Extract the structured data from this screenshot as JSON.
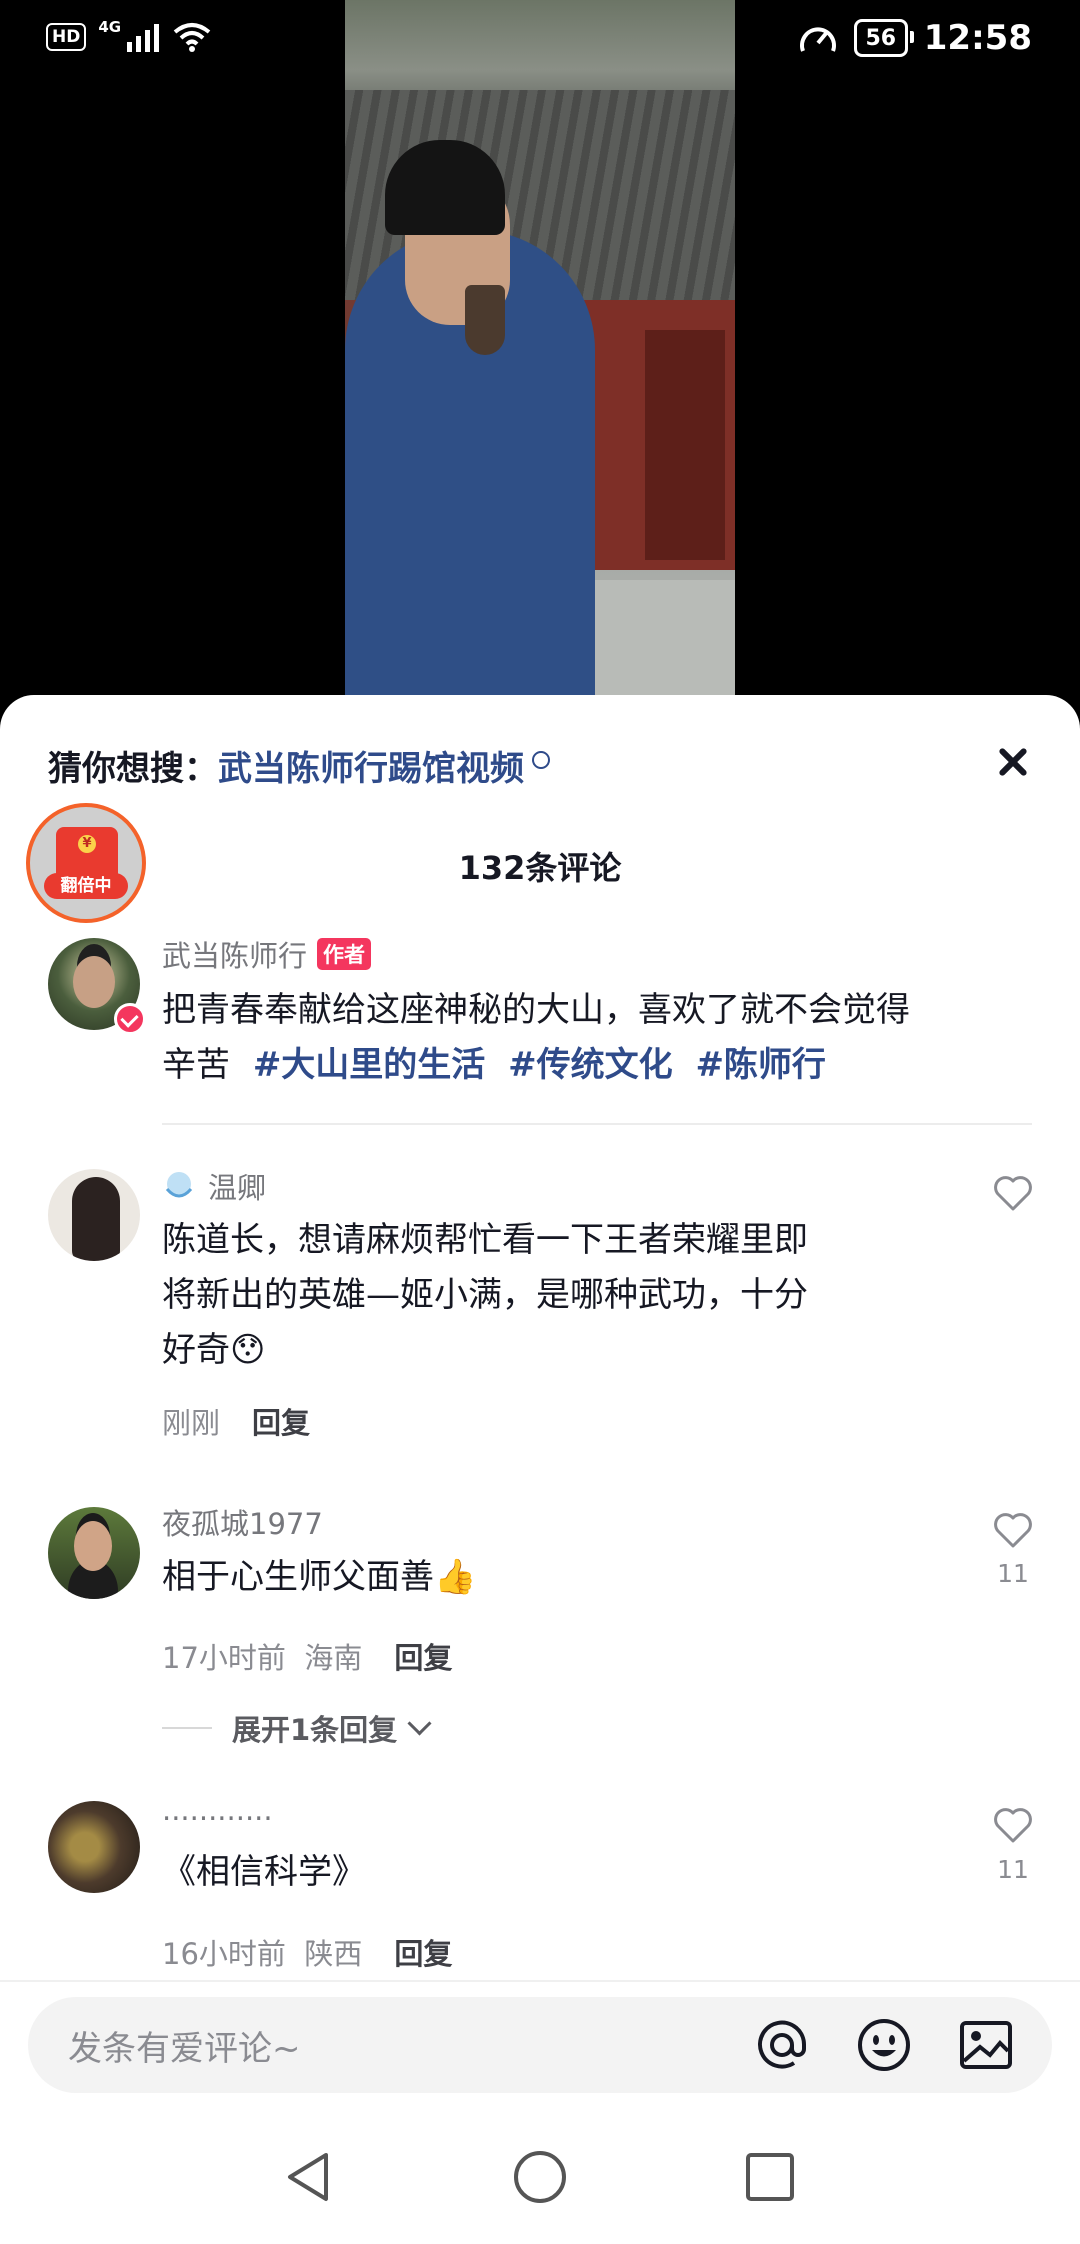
{
  "status_bar": {
    "hd": "HD",
    "network": "4G",
    "battery": "56",
    "time": "12:58"
  },
  "suggest": {
    "label": "猜你想搜：",
    "term": "武当陈师行踢馆视频"
  },
  "red_packet": {
    "label": "翻倍中"
  },
  "comments_title": "132条评论",
  "author_comment": {
    "username": "武当陈师行",
    "tag": "作者",
    "text_line1": "把青春奉献给这座神秘的大山，喜欢了就不会觉得",
    "text_line2": "辛苦",
    "hashtags": [
      "#大山里的生活",
      "#传统文化",
      "#陈师行"
    ]
  },
  "comments": [
    {
      "username": "温卿",
      "lines": [
        "陈道长，想请麻烦帮忙看一下王者荣耀里即",
        "将新出的英雄—姬小满，是哪种武功，十分",
        "好奇😯"
      ],
      "time": "刚刚",
      "location": "",
      "reply": "回复",
      "likes": ""
    },
    {
      "username": "夜孤城1977",
      "lines": [
        "相于心生师父面善👍"
      ],
      "time": "17小时前",
      "location": "海南",
      "reply": "回复",
      "likes": "11",
      "expand": "展开1条回复"
    },
    {
      "username": "............",
      "lines": [
        "《相信科学》"
      ],
      "time": "16小时前",
      "location": "陕西",
      "reply": "回复",
      "likes": "11"
    }
  ],
  "input": {
    "placeholder": "发条有爱评论~",
    "icons": [
      "at-icon",
      "emoji-icon",
      "image-icon"
    ]
  },
  "nav": {
    "icons": [
      "back-icon",
      "home-icon",
      "recents-icon"
    ]
  }
}
